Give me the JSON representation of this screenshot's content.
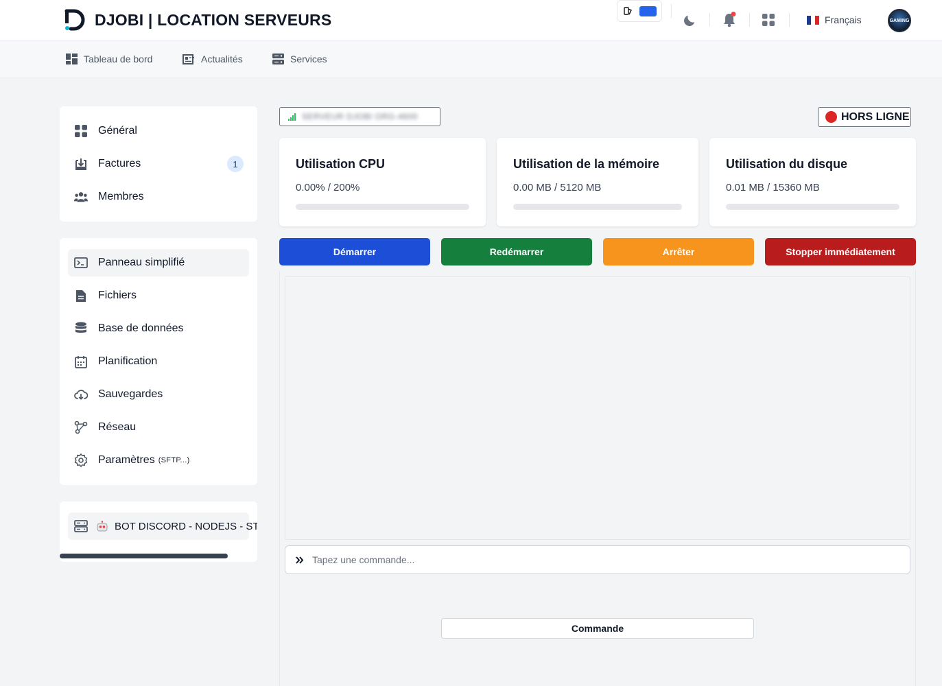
{
  "app": {
    "title": "DJOBI | LOCATION SERVEURS"
  },
  "topbar": {
    "language": "Français",
    "avatar_text": "GAMING",
    "notification_dot_color": "#ef4444"
  },
  "subnav": {
    "items": [
      {
        "label": "Tableau de bord",
        "icon": "dashboard-icon"
      },
      {
        "label": "Actualités",
        "icon": "newspaper-icon"
      },
      {
        "label": "Services",
        "icon": "server-icon"
      }
    ]
  },
  "sidebar": {
    "account": [
      {
        "label": "Général",
        "icon": "grid-icon"
      },
      {
        "label": "Factures",
        "icon": "invoice-icon",
        "badge": "1"
      },
      {
        "label": "Membres",
        "icon": "users-icon"
      }
    ],
    "server": [
      {
        "label": "Panneau simplifié",
        "icon": "terminal-icon"
      },
      {
        "label": "Fichiers",
        "icon": "file-icon"
      },
      {
        "label": "Base de données",
        "icon": "database-icon"
      },
      {
        "label": "Planification",
        "icon": "calendar-icon"
      },
      {
        "label": "Sauvegardes",
        "icon": "cloud-download-icon"
      },
      {
        "label": "Réseau",
        "icon": "network-icon"
      },
      {
        "label": "Paramètres",
        "suffix": "(SFTP...)",
        "icon": "settings-icon"
      }
    ],
    "current_service": {
      "label": "BOT DISCORD - NODEJS - ST",
      "icon": "server-stack-icon"
    }
  },
  "server": {
    "name": "SERVEUR DJOBI ORG-4600",
    "status": "HORS LIGNE",
    "status_color": "#dc2626"
  },
  "stats": [
    {
      "title": "Utilisation CPU",
      "value": "0.00% / 200%",
      "fraction": 0.0
    },
    {
      "title": "Utilisation de la mémoire",
      "value": "0.00 MB / 5120 MB",
      "fraction": 0.0
    },
    {
      "title": "Utilisation du disque",
      "value": "0.01 MB / 15360 MB",
      "fraction": 0.0
    }
  ],
  "power_buttons": [
    {
      "label": "Démarrer",
      "color": "#1d4ed8"
    },
    {
      "label": "Redémarrer",
      "color": "#15803d"
    },
    {
      "label": "Arrêter",
      "color": "#f7941d"
    },
    {
      "label": "Stopper immédiatement",
      "color": "#b91c1c"
    }
  ],
  "console": {
    "placeholder": "Tapez une commande...",
    "submit_label": "Commande"
  }
}
